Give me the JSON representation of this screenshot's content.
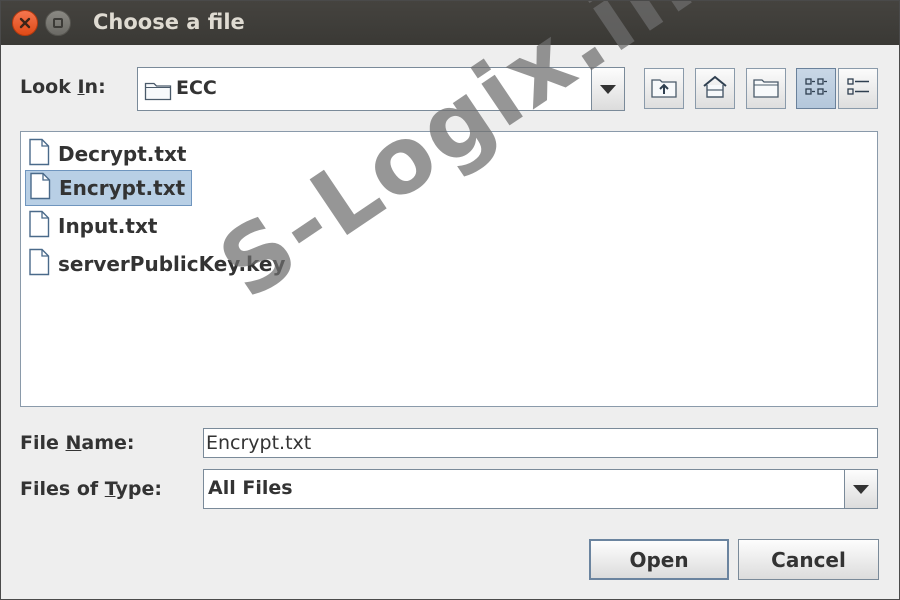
{
  "window": {
    "title": "Choose a file",
    "close_icon": "close-icon",
    "minimize_icon": "minimize-icon"
  },
  "look_in": {
    "label_pre": "Look ",
    "label_mnemonic": "I",
    "label_post": "n:",
    "value": "ECC"
  },
  "toolbar": {
    "up_icon": "folder-up-icon",
    "home_icon": "home-icon",
    "new_folder_icon": "new-folder-icon",
    "list_view_icon": "list-view-icon",
    "details_view_icon": "details-view-icon"
  },
  "files": [
    {
      "name": "Decrypt.txt",
      "selected": false
    },
    {
      "name": "Encrypt.txt",
      "selected": true
    },
    {
      "name": "Input.txt",
      "selected": false
    },
    {
      "name": "serverPublicKey.key",
      "selected": false
    }
  ],
  "file_name": {
    "label_pre": "File ",
    "label_mnemonic": "N",
    "label_post": "ame:",
    "value": "Encrypt.txt"
  },
  "file_type": {
    "label_pre": "Files of ",
    "label_mnemonic": "T",
    "label_post": "ype:",
    "value": "All Files"
  },
  "buttons": {
    "open": "Open",
    "cancel": "Cancel"
  },
  "watermark": "S-Logix.in",
  "colors": {
    "titlebar": "#3c3b37",
    "close_button": "#e9541f",
    "selection": "#b8cfe5"
  }
}
